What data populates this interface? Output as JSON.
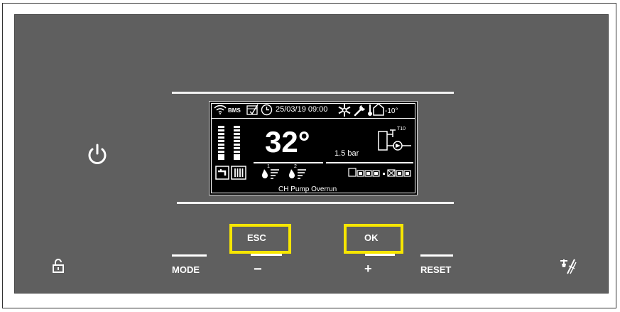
{
  "lcd": {
    "status_bar": {
      "bms_label": "BMS",
      "datetime": "25/03/19 09:00",
      "outside_temp": "-10°"
    },
    "main": {
      "temperature": "32°",
      "pressure": "1.5 bar",
      "pump_zone_label": "T10",
      "flame_1_index": "1",
      "flame_2_index": "2"
    },
    "status_message": "CH Pump Overrun"
  },
  "buttons": {
    "esc_label": "ESC",
    "ok_label": "OK",
    "mode_label": "MODE",
    "minus_label": "−",
    "plus_label": "+",
    "reset_label": "RESET"
  },
  "colors": {
    "panel": "#5f5f5f",
    "highlight": "#f7e600",
    "lcd_background": "#000000",
    "foreground": "#ffffff"
  },
  "icons": [
    "power-icon",
    "lock-icon",
    "chimney-sweep-icon",
    "wifi-icon",
    "calendar-icon",
    "clock-icon",
    "snowflake-icon",
    "wrench-icon",
    "thermometer-icon",
    "house-icon",
    "radiator-icon",
    "tap-icon",
    "pump-icon",
    "flame-icon",
    "module-icon"
  ]
}
